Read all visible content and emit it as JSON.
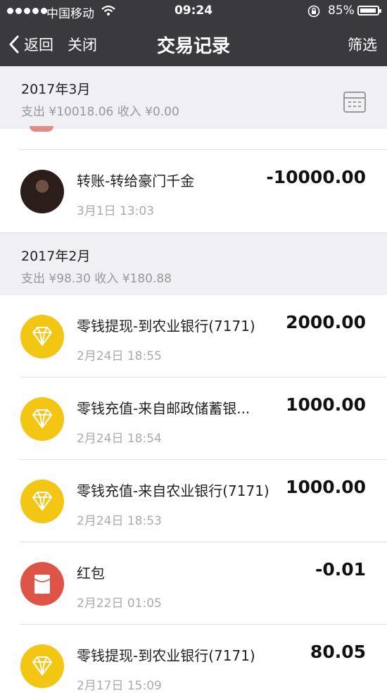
{
  "status_bar": {
    "carrier": "中国移动",
    "time": "09:24",
    "battery": "85%"
  },
  "nav": {
    "back_label": "返回",
    "close_label": "关闭",
    "title": "交易记录",
    "filter_label": "筛选"
  },
  "sections": [
    {
      "month": "2017年3月",
      "summary": "支出 ¥10018.06 收入 ¥0.00",
      "rows": [
        {
          "icon": "avatar",
          "name": "转账-转给豪门千金",
          "date": "3月1日 13:03",
          "amount": "-10000.00"
        }
      ]
    },
    {
      "month": "2017年2月",
      "summary": "支出 ¥98.30 收入 ¥180.88",
      "rows": [
        {
          "icon": "diamond-icon",
          "name": "零钱提现-到农业银行(7171)",
          "date": "2月24日 18:55",
          "amount": "2000.00"
        },
        {
          "icon": "diamond-icon",
          "name": "零钱充值-来自邮政储蓄银...",
          "date": "2月24日 18:54",
          "amount": "1000.00"
        },
        {
          "icon": "diamond-icon",
          "name": "零钱充值-来自农业银行(7171)",
          "date": "2月24日 18:53",
          "amount": "1000.00"
        },
        {
          "icon": "red-packet-icon",
          "name": "红包",
          "date": "2月22日 01:05",
          "amount": "-0.01"
        },
        {
          "icon": "diamond-icon",
          "name": "零钱提现-到农业银行(7171)",
          "date": "2月17日 15:09",
          "amount": "80.05"
        }
      ]
    }
  ],
  "colors": {
    "nav_bg": "#3a3a3e",
    "diamond_icon_bg": "#f2c613",
    "red_packet_bg": "#dd5447",
    "section_bg": "#efeff4"
  }
}
